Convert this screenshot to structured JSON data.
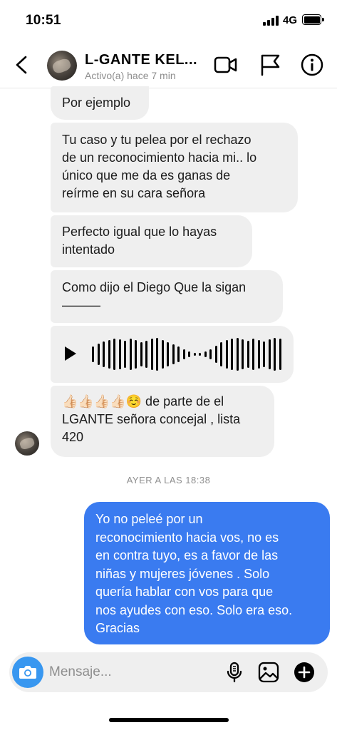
{
  "status_bar": {
    "time": "10:51",
    "network": "4G"
  },
  "header": {
    "contact_name": "L-GANTE KEL...",
    "contact_status": "Activo(a) hace 7 min",
    "icons": [
      "back-icon",
      "video-call-icon",
      "flag-icon",
      "info-icon"
    ]
  },
  "messages": [
    {
      "direction": "incoming",
      "text": "Por ejemplo"
    },
    {
      "direction": "incoming",
      "text": "Tu caso y tu pelea por el rechazo\nde un reconocimiento hacia mi.. lo\núnico que me da es ganas de\nreírme en su cara señora"
    },
    {
      "direction": "incoming",
      "text": "Perfecto igual que lo hayas\nintentado"
    },
    {
      "direction": "incoming",
      "text": "Como dijo el Diego Que la sigan\n———"
    },
    {
      "direction": "incoming",
      "type": "audio",
      "icon": "play-icon"
    },
    {
      "direction": "incoming",
      "text": "👍🏻👍🏻👍🏻👍🏻☺️  de parte de el\nLGANTE señora concejal , lista\n420"
    },
    {
      "direction": "outgoing",
      "text": "Yo no peleé por un\nreconocimiento hacia vos, no es\nen contra tuyo, es a favor de las\nniñas y mujeres jóvenes . Solo\nquería hablar con vos para que\nnos ayudes con eso. Solo era eso.\nGracias"
    }
  ],
  "timestamp": "AYER A LAS 18:38",
  "composer": {
    "placeholder": "Mensaje...",
    "icons": [
      "camera-icon",
      "microphone-icon",
      "gallery-icon",
      "plus-icon"
    ]
  },
  "colors": {
    "outgoing_bubble": "#3a7bf0",
    "incoming_bubble": "#efefef",
    "camera_button": "#3897f0",
    "muted_text": "#8e8e8e"
  }
}
